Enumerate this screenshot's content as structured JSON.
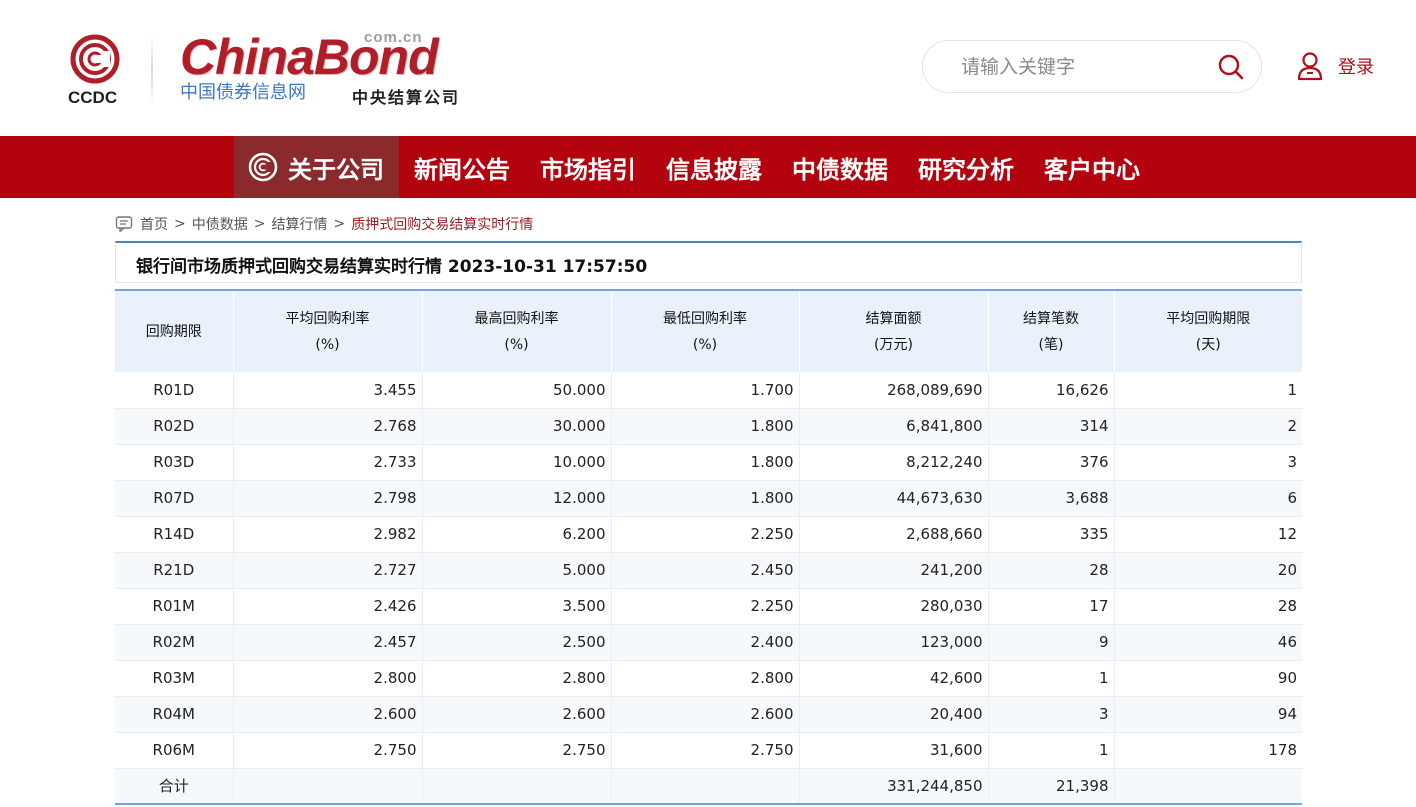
{
  "header": {
    "ccdc_text": "CCDC",
    "brand_word": "ChinaBond",
    "brand_domain": "com.cn",
    "brand_cn": "中国债券信息网",
    "brand_cn2": "中央结算公司",
    "search_placeholder": "请输入关键字",
    "login_label": "登录"
  },
  "nav": {
    "items": [
      {
        "label": "关于公司",
        "active": true
      },
      {
        "label": "新闻公告"
      },
      {
        "label": "市场指引"
      },
      {
        "label": "信息披露"
      },
      {
        "label": "中债数据"
      },
      {
        "label": "研究分析"
      },
      {
        "label": "客户中心"
      }
    ]
  },
  "breadcrumb": {
    "home": "首页",
    "sep": ">",
    "level1": "中债数据",
    "level2": "结算行情",
    "current": "质押式回购交易结算实时行情"
  },
  "title": "银行间市场质押式回购交易结算实时行情 2023-10-31 17:57:50",
  "table": {
    "headers": [
      {
        "line1": "回购期限",
        "line2": ""
      },
      {
        "line1": "平均回购利率",
        "line2": "(%)"
      },
      {
        "line1": "最高回购利率",
        "line2": "(%)"
      },
      {
        "line1": "最低回购利率",
        "line2": "(%)"
      },
      {
        "line1": "结算面额",
        "line2": "(万元)"
      },
      {
        "line1": "结算笔数",
        "line2": "(笔)"
      },
      {
        "line1": "平均回购期限",
        "line2": "(天)"
      }
    ],
    "rows": [
      [
        "R01D",
        "3.455",
        "50.000",
        "1.700",
        "268,089,690",
        "16,626",
        "1"
      ],
      [
        "R02D",
        "2.768",
        "30.000",
        "1.800",
        "6,841,800",
        "314",
        "2"
      ],
      [
        "R03D",
        "2.733",
        "10.000",
        "1.800",
        "8,212,240",
        "376",
        "3"
      ],
      [
        "R07D",
        "2.798",
        "12.000",
        "1.800",
        "44,673,630",
        "3,688",
        "6"
      ],
      [
        "R14D",
        "2.982",
        "6.200",
        "2.250",
        "2,688,660",
        "335",
        "12"
      ],
      [
        "R21D",
        "2.727",
        "5.000",
        "2.450",
        "241,200",
        "28",
        "20"
      ],
      [
        "R01M",
        "2.426",
        "3.500",
        "2.250",
        "280,030",
        "17",
        "28"
      ],
      [
        "R02M",
        "2.457",
        "2.500",
        "2.400",
        "123,000",
        "9",
        "46"
      ],
      [
        "R03M",
        "2.800",
        "2.800",
        "2.800",
        "42,600",
        "1",
        "90"
      ],
      [
        "R04M",
        "2.600",
        "2.600",
        "2.600",
        "20,400",
        "3",
        "94"
      ],
      [
        "R06M",
        "2.750",
        "2.750",
        "2.750",
        "31,600",
        "1",
        "178"
      ],
      [
        "合计",
        "",
        "",
        "",
        "331,244,850",
        "21,398",
        ""
      ]
    ]
  },
  "colors": {
    "nav_bg": "#b3030f",
    "nav_active_bg": "#8a2a2d",
    "brand_red": "#b01e2a",
    "table_header_bg": "#e9f2fb",
    "accent_blue": "#4a86c5"
  }
}
